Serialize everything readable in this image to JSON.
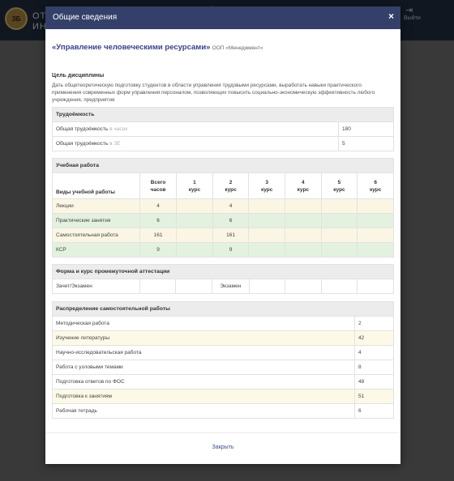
{
  "app": {
    "logo_text": "ЗБ",
    "title_line1": "ОТ",
    "title_line2": "ИН",
    "logout_label": "Выйти"
  },
  "modal": {
    "title": "Общие сведения",
    "close_icon": "×",
    "course_name": "«Управление человеческими ресурсами»",
    "course_program": "ООП «Менеджмент»",
    "goal_title": "Цель дисциплины",
    "goal_text": "Дать общетеоретическую подготовку студентов в области управления трудовыми ресурсами, выработать навыки практического применения современных форм управления персоналом, позволяющих повысить социально-экономическую эффективность любого учреждения, предприятия",
    "labor": {
      "title": "Трудоёмкость",
      "rows": [
        {
          "label": "Общая трудоёмкость",
          "unit": "в часах",
          "value": "180"
        },
        {
          "label": "Общая трудоёмкость",
          "unit": "в ЗЕ",
          "value": "5"
        }
      ]
    },
    "study": {
      "title": "Учебная работа",
      "columns": [
        "Виды учебной работы",
        "Всего часов",
        "1 курс",
        "2 курс",
        "3 курс",
        "4 курс",
        "5 курс",
        "6 курс"
      ],
      "col_top": [
        "",
        "Всего",
        "1",
        "2",
        "3",
        "4",
        "5",
        "6"
      ],
      "col_bottom": [
        "Виды учебной работы",
        "часов",
        "курс",
        "курс",
        "курс",
        "курс",
        "курс",
        "курс"
      ],
      "rows": [
        {
          "cells": [
            "Лекции",
            "4",
            "",
            "4",
            "",
            "",
            "",
            ""
          ],
          "tone": "beige"
        },
        {
          "cells": [
            "Практические занятия",
            "6",
            "",
            "6",
            "",
            "",
            "",
            ""
          ],
          "tone": "green"
        },
        {
          "cells": [
            "Самостоятельная работа",
            "161",
            "",
            "161",
            "",
            "",
            "",
            ""
          ],
          "tone": "beige"
        },
        {
          "cells": [
            "КСР",
            "9",
            "",
            "9",
            "",
            "",
            "",
            ""
          ],
          "tone": "green"
        }
      ]
    },
    "certification": {
      "title": "Форма и курс промежуточной аттестации",
      "row": [
        "Зачет/Экзамен",
        "",
        "",
        "Экзамен",
        "",
        "",
        "",
        ""
      ]
    },
    "self_work": {
      "title": "Распределение самостоятельной работы",
      "rows": [
        {
          "label": "Методическая работа",
          "value": "2",
          "tone": ""
        },
        {
          "label": "Изучение литературы",
          "value": "42",
          "tone": "beige"
        },
        {
          "label": "Научно-исследовательская работа",
          "value": "4",
          "tone": ""
        },
        {
          "label": "Работа с узловыми темами",
          "value": "8",
          "tone": ""
        },
        {
          "label": "Подготовка ответов по ФОС",
          "value": "48",
          "tone": ""
        },
        {
          "label": "Подготовка к занятиям",
          "value": "51",
          "tone": "beige"
        },
        {
          "label": "Рабочая тетрадь",
          "value": "6",
          "tone": ""
        }
      ]
    },
    "close_label": "Закрыть"
  }
}
